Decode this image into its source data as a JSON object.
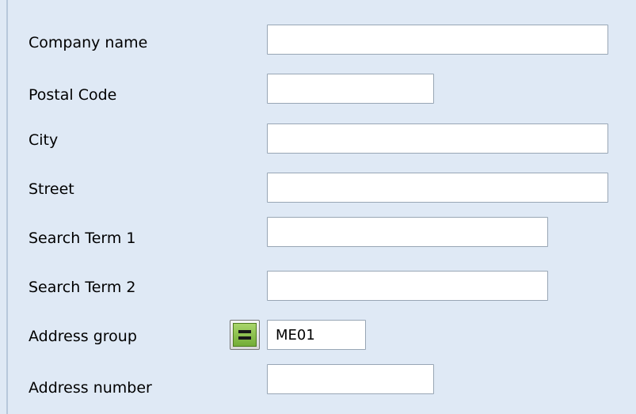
{
  "form": {
    "company_name": {
      "label": "Company name",
      "value": ""
    },
    "postal_code": {
      "label": "Postal Code",
      "value": ""
    },
    "city": {
      "label": "City",
      "value": ""
    },
    "street": {
      "label": "Street",
      "value": ""
    },
    "search_term_1": {
      "label": "Search Term 1",
      "value": ""
    },
    "search_term_2": {
      "label": "Search Term 2",
      "value": ""
    },
    "address_group": {
      "label": "Address group",
      "value": "ME01",
      "selection_option_icon": "equals-icon"
    },
    "address_number": {
      "label": "Address number",
      "value": ""
    }
  },
  "colors": {
    "panel_background": "#dfe9f5",
    "field_border": "#98a6b5",
    "selection_button_green": "#7db33c"
  }
}
